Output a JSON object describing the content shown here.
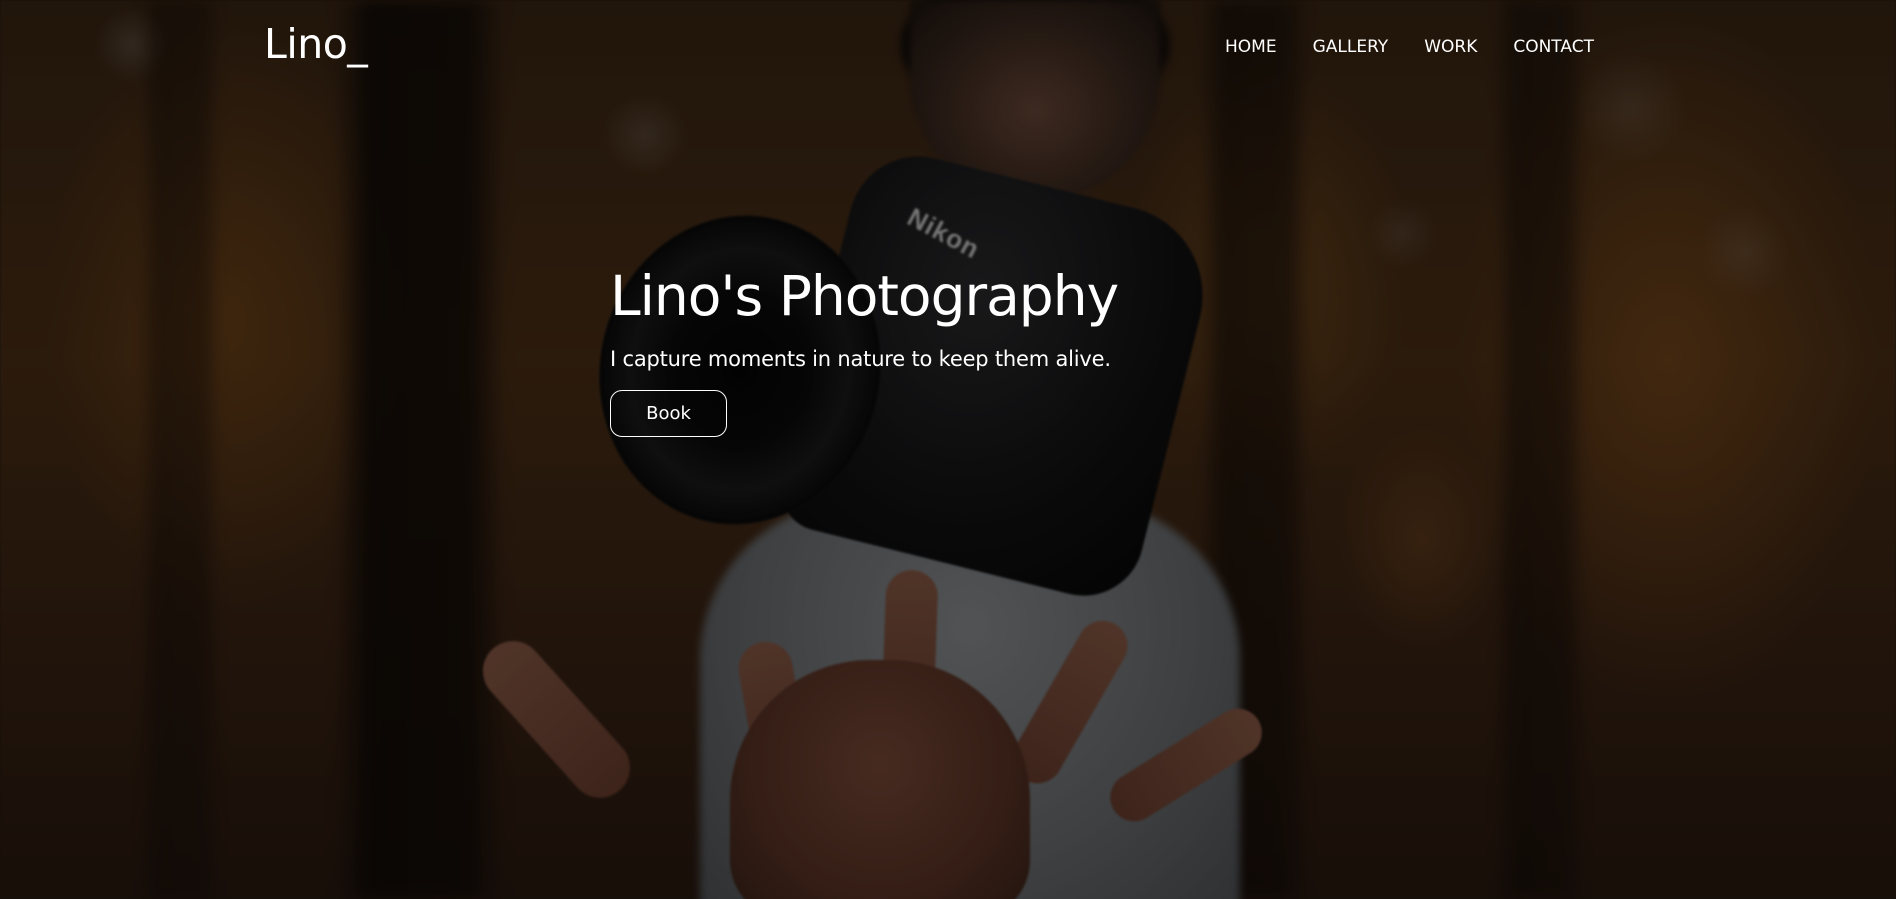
{
  "header": {
    "logo_text": "Lino_",
    "nav": [
      {
        "label": "HOME"
      },
      {
        "label": "GALLERY"
      },
      {
        "label": "WORK"
      },
      {
        "label": "CONTACT"
      }
    ]
  },
  "hero": {
    "title": "Lino's Photography",
    "subtitle": "I capture moments in nature to keep them alive.",
    "button_label": "Book"
  },
  "background": {
    "camera_brand": "Nikon"
  },
  "colors": {
    "text": "#ffffff",
    "overlay": "rgba(0,0,0,0.42)"
  }
}
